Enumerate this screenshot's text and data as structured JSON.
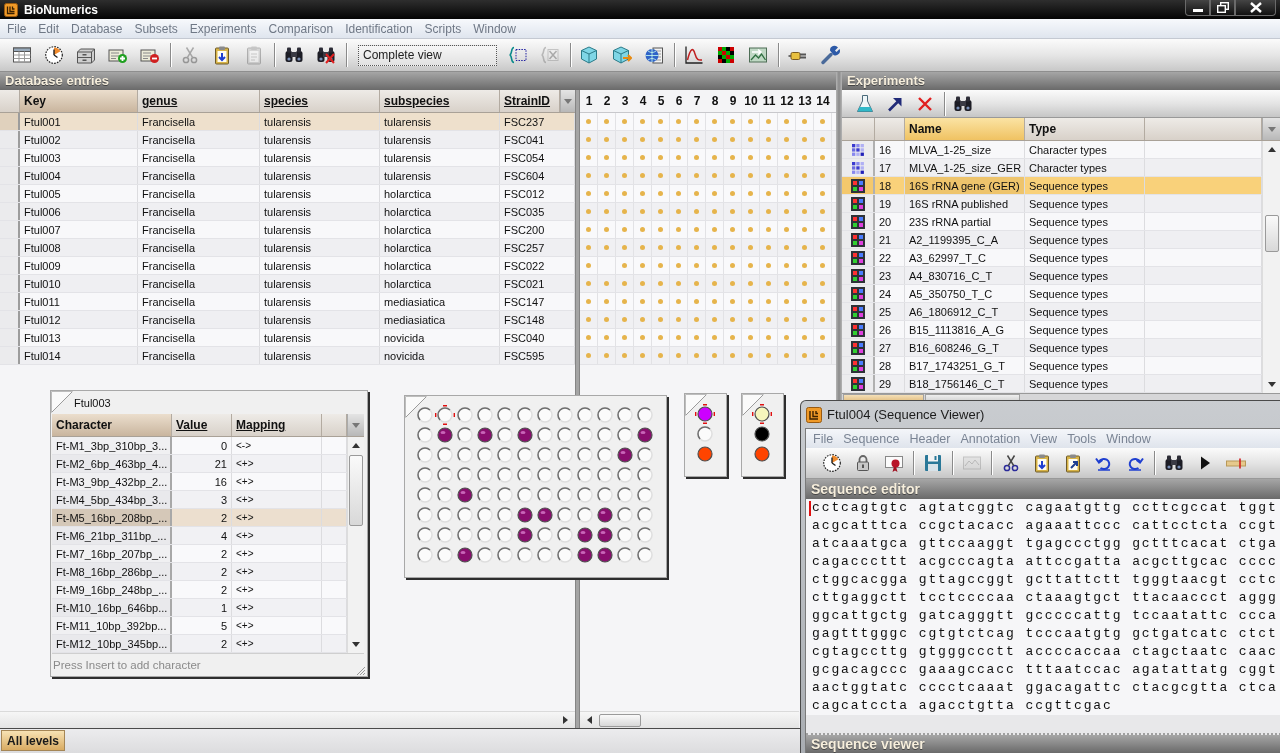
{
  "window": {
    "title": "BioNumerics"
  },
  "menu": [
    "File",
    "Edit",
    "Database",
    "Subsets",
    "Experiments",
    "Comparison",
    "Identification",
    "Scripts",
    "Window"
  ],
  "toolbar": [
    [
      {
        "kind": "table",
        "disabled": false
      },
      {
        "kind": "clock",
        "disabled": false
      },
      {
        "kind": "cabinet",
        "disabled": false
      },
      {
        "kind": "card-add",
        "disabled": false
      },
      {
        "kind": "card-remove",
        "disabled": false
      }
    ],
    [
      {
        "kind": "cut",
        "disabled": true
      },
      {
        "kind": "paste",
        "disabled": false
      },
      {
        "kind": "clipboard",
        "disabled": true
      }
    ],
    [
      {
        "kind": "find",
        "disabled": false
      },
      {
        "kind": "find-clear",
        "disabled": false
      }
    ],
    [
      {
        "kind": "select",
        "value": "Complete view"
      },
      {
        "kind": "bracket",
        "disabled": false
      },
      {
        "kind": "bracket-clear",
        "disabled": true
      }
    ],
    [
      {
        "kind": "cube",
        "disabled": false
      },
      {
        "kind": "cube-arrow",
        "disabled": false
      },
      {
        "kind": "globe",
        "disabled": false
      }
    ],
    [
      {
        "kind": "curve",
        "disabled": false
      },
      {
        "kind": "matrix",
        "disabled": false
      },
      {
        "kind": "picture",
        "disabled": false
      }
    ],
    [
      {
        "kind": "plug",
        "disabled": false
      },
      {
        "kind": "tool",
        "disabled": false
      }
    ]
  ],
  "database": {
    "title": "Database entries",
    "columns": [
      "Key",
      "genus",
      "species",
      "subspecies",
      "StrainID"
    ],
    "experiment_columns": [
      "1",
      "2",
      "3",
      "4",
      "5",
      "6",
      "7",
      "8",
      "9",
      "10",
      "11",
      "12",
      "13",
      "14"
    ],
    "rows": [
      {
        "selected": true,
        "cells": [
          "Ftul001",
          "Francisella",
          "tularensis",
          "tularensis",
          "FSC237"
        ],
        "experiments": [
          true,
          true,
          true,
          true,
          true,
          true,
          true,
          true,
          true,
          true,
          true,
          true,
          true,
          true
        ]
      },
      {
        "selected": false,
        "cells": [
          "Ftul002",
          "Francisella",
          "tularensis",
          "tularensis",
          "FSC041"
        ],
        "experiments": [
          true,
          true,
          true,
          true,
          true,
          true,
          true,
          true,
          true,
          true,
          true,
          true,
          true,
          true
        ]
      },
      {
        "selected": false,
        "cells": [
          "Ftul003",
          "Francisella",
          "tularensis",
          "tularensis",
          "FSC054"
        ],
        "experiments": [
          true,
          true,
          true,
          true,
          true,
          true,
          true,
          true,
          true,
          true,
          true,
          true,
          true,
          true
        ]
      },
      {
        "selected": false,
        "cells": [
          "Ftul004",
          "Francisella",
          "tularensis",
          "tularensis",
          "FSC604"
        ],
        "experiments": [
          true,
          true,
          true,
          true,
          true,
          true,
          true,
          true,
          true,
          true,
          true,
          true,
          true,
          true
        ]
      },
      {
        "selected": false,
        "cells": [
          "Ftul005",
          "Francisella",
          "tularensis",
          "holarctica",
          "FSC012"
        ],
        "experiments": [
          true,
          true,
          true,
          true,
          true,
          true,
          true,
          true,
          true,
          true,
          true,
          true,
          true,
          true
        ]
      },
      {
        "selected": false,
        "cells": [
          "Ftul006",
          "Francisella",
          "tularensis",
          "holarctica",
          "FSC035"
        ],
        "experiments": [
          true,
          true,
          true,
          true,
          true,
          true,
          true,
          true,
          true,
          true,
          true,
          true,
          true,
          true
        ]
      },
      {
        "selected": false,
        "cells": [
          "Ftul007",
          "Francisella",
          "tularensis",
          "holarctica",
          "FSC200"
        ],
        "experiments": [
          true,
          true,
          true,
          true,
          true,
          true,
          true,
          true,
          true,
          true,
          true,
          true,
          true,
          true
        ]
      },
      {
        "selected": false,
        "cells": [
          "Ftul008",
          "Francisella",
          "tularensis",
          "holarctica",
          "FSC257"
        ],
        "experiments": [
          true,
          true,
          true,
          true,
          true,
          true,
          true,
          true,
          true,
          true,
          true,
          true,
          true,
          true
        ]
      },
      {
        "selected": false,
        "cells": [
          "Ftul009",
          "Francisella",
          "tularensis",
          "holarctica",
          "FSC022"
        ],
        "experiments": [
          true,
          false,
          true,
          true,
          true,
          true,
          true,
          true,
          true,
          true,
          true,
          true,
          true,
          true
        ]
      },
      {
        "selected": false,
        "cells": [
          "Ftul010",
          "Francisella",
          "tularensis",
          "holarctica",
          "FSC021"
        ],
        "experiments": [
          true,
          true,
          true,
          true,
          true,
          true,
          true,
          true,
          true,
          true,
          true,
          true,
          true,
          true
        ]
      },
      {
        "selected": false,
        "cells": [
          "Ftul011",
          "Francisella",
          "tularensis",
          "mediasiatica",
          "FSC147"
        ],
        "experiments": [
          true,
          true,
          true,
          true,
          true,
          true,
          true,
          true,
          true,
          true,
          true,
          true,
          true,
          true
        ]
      },
      {
        "selected": false,
        "cells": [
          "Ftul012",
          "Francisella",
          "tularensis",
          "mediasiatica",
          "FSC148"
        ],
        "experiments": [
          true,
          true,
          true,
          true,
          true,
          true,
          true,
          true,
          true,
          true,
          true,
          true,
          true,
          true
        ]
      },
      {
        "selected": false,
        "cells": [
          "Ftul013",
          "Francisella",
          "tularensis",
          "novicida",
          "FSC040"
        ],
        "experiments": [
          true,
          true,
          true,
          true,
          true,
          true,
          true,
          true,
          true,
          true,
          true,
          true,
          true,
          true
        ]
      },
      {
        "selected": false,
        "cells": [
          "Ftul014",
          "Francisella",
          "tularensis",
          "novicida",
          "FSC595"
        ],
        "experiments": [
          true,
          true,
          true,
          true,
          true,
          true,
          true,
          true,
          true,
          true,
          true,
          true,
          true,
          true
        ]
      }
    ]
  },
  "experiments": {
    "title": "Experiments",
    "columns": [
      {
        "label": "Name",
        "sorted": true
      },
      {
        "label": "Type",
        "sorted": false
      }
    ],
    "rows": [
      {
        "kind": "character",
        "number": "16",
        "name": "MLVA_1-25_size",
        "type": "Character types",
        "selected": false
      },
      {
        "kind": "character",
        "number": "17",
        "name": "MLVA_1-25_size_GER",
        "type": "Character types",
        "selected": false
      },
      {
        "kind": "sequence",
        "number": "18",
        "name": "16S rRNA gene (GER)",
        "type": "Sequence types",
        "selected": true
      },
      {
        "kind": "sequence",
        "number": "19",
        "name": "16S rRNA published",
        "type": "Sequence types",
        "selected": false
      },
      {
        "kind": "sequence",
        "number": "20",
        "name": "23S rRNA partial",
        "type": "Sequence types",
        "selected": false
      },
      {
        "kind": "sequence",
        "number": "21",
        "name": "A2_1199395_C_A",
        "type": "Sequence types",
        "selected": false
      },
      {
        "kind": "sequence",
        "number": "22",
        "name": "A3_62997_T_C",
        "type": "Sequence types",
        "selected": false
      },
      {
        "kind": "sequence",
        "number": "23",
        "name": "A4_830716_C_T",
        "type": "Sequence types",
        "selected": false
      },
      {
        "kind": "sequence",
        "number": "24",
        "name": "A5_350750_T_C",
        "type": "Sequence types",
        "selected": false
      },
      {
        "kind": "sequence",
        "number": "25",
        "name": "A6_1806912_C_T",
        "type": "Sequence types",
        "selected": false
      },
      {
        "kind": "sequence",
        "number": "26",
        "name": "B15_1113816_A_G",
        "type": "Sequence types",
        "selected": false
      },
      {
        "kind": "sequence",
        "number": "27",
        "name": "B16_608246_G_T",
        "type": "Sequence types",
        "selected": false
      },
      {
        "kind": "sequence",
        "number": "28",
        "name": "B17_1743251_G_T",
        "type": "Sequence types",
        "selected": false
      },
      {
        "kind": "sequence",
        "number": "29",
        "name": "B18_1756146_C_T",
        "type": "Sequence types",
        "selected": false
      }
    ],
    "tabs": [
      {
        "selected": true
      },
      {
        "selected": false
      }
    ]
  },
  "character_panel": {
    "title": "Ftul003",
    "columns": [
      "Character",
      "Value",
      "Mapping"
    ],
    "rows": [
      {
        "character": "Ft-M1_3bp_310bp_3...",
        "value": "0",
        "mapping": "<->",
        "selected": false
      },
      {
        "character": "Ft-M2_6bp_463bp_4...",
        "value": "21",
        "mapping": "<+>",
        "selected": false
      },
      {
        "character": "Ft-M3_9bp_432bp_2...",
        "value": "16",
        "mapping": "<+>",
        "selected": false
      },
      {
        "character": "Ft-M4_5bp_434bp_3...",
        "value": "3",
        "mapping": "<+>",
        "selected": false
      },
      {
        "character": "Ft-M5_16bp_208bp_...",
        "value": "2",
        "mapping": "<+>",
        "selected": true
      },
      {
        "character": "Ft-M6_21bp_311bp_...",
        "value": "4",
        "mapping": "<+>",
        "selected": false
      },
      {
        "character": "Ft-M7_16bp_207bp_...",
        "value": "2",
        "mapping": "<+>",
        "selected": false
      },
      {
        "character": "Ft-M8_16bp_286bp_...",
        "value": "2",
        "mapping": "<+>",
        "selected": false
      },
      {
        "character": "Ft-M9_16bp_248bp_...",
        "value": "2",
        "mapping": "<+>",
        "selected": false
      },
      {
        "character": "Ft-M10_16bp_646bp...",
        "value": "1",
        "mapping": "<+>",
        "selected": false
      },
      {
        "character": "Ft-M11_10bp_392bp...",
        "value": "5",
        "mapping": "<+>",
        "selected": false
      },
      {
        "character": "Ft-M12_10bp_345bp...",
        "value": "2",
        "mapping": "<+>",
        "selected": false
      }
    ],
    "hint": "Press Insert to add character"
  },
  "plate": {
    "rows": [
      [
        {
          "filled": false,
          "selected": false
        },
        {
          "filled": false,
          "selected": true
        },
        {
          "filled": false,
          "selected": false
        },
        {
          "filled": false,
          "selected": false
        },
        {
          "filled": false,
          "selected": false
        },
        {
          "filled": false,
          "selected": false
        },
        {
          "filled": false,
          "selected": false
        },
        {
          "filled": false,
          "selected": false
        },
        {
          "filled": false,
          "selected": false
        },
        {
          "filled": false,
          "selected": false
        },
        {
          "filled": false,
          "selected": false
        },
        {
          "filled": false,
          "selected": false
        }
      ],
      [
        {
          "filled": false,
          "selected": false
        },
        {
          "filled": true,
          "selected": false
        },
        {
          "filled": false,
          "selected": false
        },
        {
          "filled": true,
          "selected": false
        },
        {
          "filled": false,
          "selected": false
        },
        {
          "filled": true,
          "selected": false
        },
        {
          "filled": false,
          "selected": false
        },
        {
          "filled": false,
          "selected": false
        },
        {
          "filled": false,
          "selected": false
        },
        {
          "filled": false,
          "selected": false
        },
        {
          "filled": false,
          "selected": false
        },
        {
          "filled": true,
          "selected": false
        }
      ],
      [
        {
          "filled": false,
          "selected": false
        },
        {
          "filled": false,
          "selected": false
        },
        {
          "filled": false,
          "selected": false
        },
        {
          "filled": false,
          "selected": false
        },
        {
          "filled": false,
          "selected": false
        },
        {
          "filled": false,
          "selected": false
        },
        {
          "filled": false,
          "selected": false
        },
        {
          "filled": false,
          "selected": false
        },
        {
          "filled": false,
          "selected": false
        },
        {
          "filled": false,
          "selected": false
        },
        {
          "filled": true,
          "selected": false
        },
        {
          "filled": false,
          "selected": false
        }
      ],
      [
        {
          "filled": false,
          "selected": false
        },
        {
          "filled": false,
          "selected": false
        },
        {
          "filled": false,
          "selected": false
        },
        {
          "filled": false,
          "selected": false
        },
        {
          "filled": false,
          "selected": false
        },
        {
          "filled": false,
          "selected": false
        },
        {
          "filled": false,
          "selected": false
        },
        {
          "filled": false,
          "selected": false
        },
        {
          "filled": false,
          "selected": false
        },
        {
          "filled": false,
          "selected": false
        },
        {
          "filled": false,
          "selected": false
        },
        {
          "filled": false,
          "selected": false
        }
      ],
      [
        {
          "filled": false,
          "selected": false
        },
        {
          "filled": false,
          "selected": false
        },
        {
          "filled": true,
          "selected": false
        },
        {
          "filled": false,
          "selected": false
        },
        {
          "filled": false,
          "selected": false
        },
        {
          "filled": false,
          "selected": false
        },
        {
          "filled": false,
          "selected": false
        },
        {
          "filled": false,
          "selected": false
        },
        {
          "filled": false,
          "selected": false
        },
        {
          "filled": false,
          "selected": false
        },
        {
          "filled": false,
          "selected": false
        },
        {
          "filled": false,
          "selected": false
        }
      ],
      [
        {
          "filled": false,
          "selected": false
        },
        {
          "filled": false,
          "selected": false
        },
        {
          "filled": false,
          "selected": false
        },
        {
          "filled": false,
          "selected": false
        },
        {
          "filled": false,
          "selected": false
        },
        {
          "filled": true,
          "selected": false
        },
        {
          "filled": true,
          "selected": false
        },
        {
          "filled": false,
          "selected": false
        },
        {
          "filled": false,
          "selected": false
        },
        {
          "filled": true,
          "selected": false
        },
        {
          "filled": false,
          "selected": false
        },
        {
          "filled": false,
          "selected": false
        }
      ],
      [
        {
          "filled": false,
          "selected": false
        },
        {
          "filled": false,
          "selected": false
        },
        {
          "filled": false,
          "selected": false
        },
        {
          "filled": false,
          "selected": false
        },
        {
          "filled": false,
          "selected": false
        },
        {
          "filled": true,
          "selected": false
        },
        {
          "filled": false,
          "selected": false
        },
        {
          "filled": false,
          "selected": false
        },
        {
          "filled": true,
          "selected": false
        },
        {
          "filled": true,
          "selected": false
        },
        {
          "filled": false,
          "selected": false
        },
        {
          "filled": false,
          "selected": false
        }
      ],
      [
        {
          "filled": false,
          "selected": false
        },
        {
          "filled": false,
          "selected": false
        },
        {
          "filled": true,
          "selected": false
        },
        {
          "filled": false,
          "selected": false
        },
        {
          "filled": false,
          "selected": false
        },
        {
          "filled": false,
          "selected": false
        },
        {
          "filled": false,
          "selected": false
        },
        {
          "filled": false,
          "selected": false
        },
        {
          "filled": true,
          "selected": false
        },
        {
          "filled": true,
          "selected": false
        },
        {
          "filled": false,
          "selected": false
        },
        {
          "filled": false,
          "selected": false
        }
      ]
    ]
  },
  "small_plates": [
    {
      "wells": [
        {
          "filled": true,
          "color": "#cc00ff",
          "selected": true
        },
        {
          "filled": false,
          "selected": false
        },
        {
          "filled": true,
          "color": "#ff4400",
          "selected": false
        }
      ]
    },
    {
      "wells": [
        {
          "filled": true,
          "color": "#f6f6bc",
          "selected": true
        },
        {
          "filled": true,
          "color": "#000000",
          "selected": false
        },
        {
          "filled": true,
          "color": "#ff4400",
          "selected": false
        }
      ]
    }
  ],
  "sequence_viewer": {
    "title": "Ftul004 (Sequence Viewer)",
    "menu": [
      "File",
      "Sequence",
      "Header",
      "Annotation",
      "View",
      "Tools",
      "Window"
    ],
    "toolbar": [
      [
        {
          "kind": "clock",
          "disabled": false
        },
        {
          "kind": "lock",
          "disabled": false
        },
        {
          "kind": "seal",
          "disabled": false
        }
      ],
      [
        {
          "kind": "save",
          "disabled": false
        }
      ],
      [
        {
          "kind": "chart",
          "disabled": true
        }
      ],
      [
        {
          "kind": "cut",
          "disabled": false
        },
        {
          "kind": "paste",
          "disabled": false
        },
        {
          "kind": "paste-out",
          "disabled": false
        },
        {
          "kind": "undo",
          "disabled": false
        },
        {
          "kind": "redo",
          "disabled": false
        }
      ],
      [
        {
          "kind": "find",
          "disabled": false
        },
        {
          "kind": "play",
          "disabled": false
        },
        {
          "kind": "ruler",
          "disabled": false
        }
      ]
    ],
    "editor_title": "Sequence editor",
    "lines": [
      "cctcagtgtc agtatcggtc cagaatgttg ccttcgccat tggt",
      "acgcatttca ccgctacacc agaaattccc cattcctcta ccgt",
      "atcaaatgca gttccaaggt tgagccctgg gctttcacat ctga",
      "cagacccttt acgcccagta attccgatta acgcttgcac cccc",
      "ctggcacgga gttagccggt gcttattctt tgggtaacgt cctc",
      "cttgaggctt tcctccccaa ctaaagtgct ttacaaccct aggg",
      "ggcattgctg gatcagggtt gcccccattg tccaatattc ccca",
      "gagtttgggc cgtgtctcag tcccaatgtg gctgatcatc ctct",
      "cgtagccttg gtgggccctt accccaccaa ctagctaatc caac",
      "gcgacagccc gaaagccacc tttaatccac agatattatg cggt",
      "aactggtatc cccctcaaat ggacagattc ctacgcgtta ctca",
      "cagcatccta agacctgtta ccgttcgac"
    ],
    "viewer_title": "Sequence viewer"
  },
  "status_bar": {
    "tabs": [
      {
        "label": "All levels",
        "selected": true
      }
    ]
  }
}
